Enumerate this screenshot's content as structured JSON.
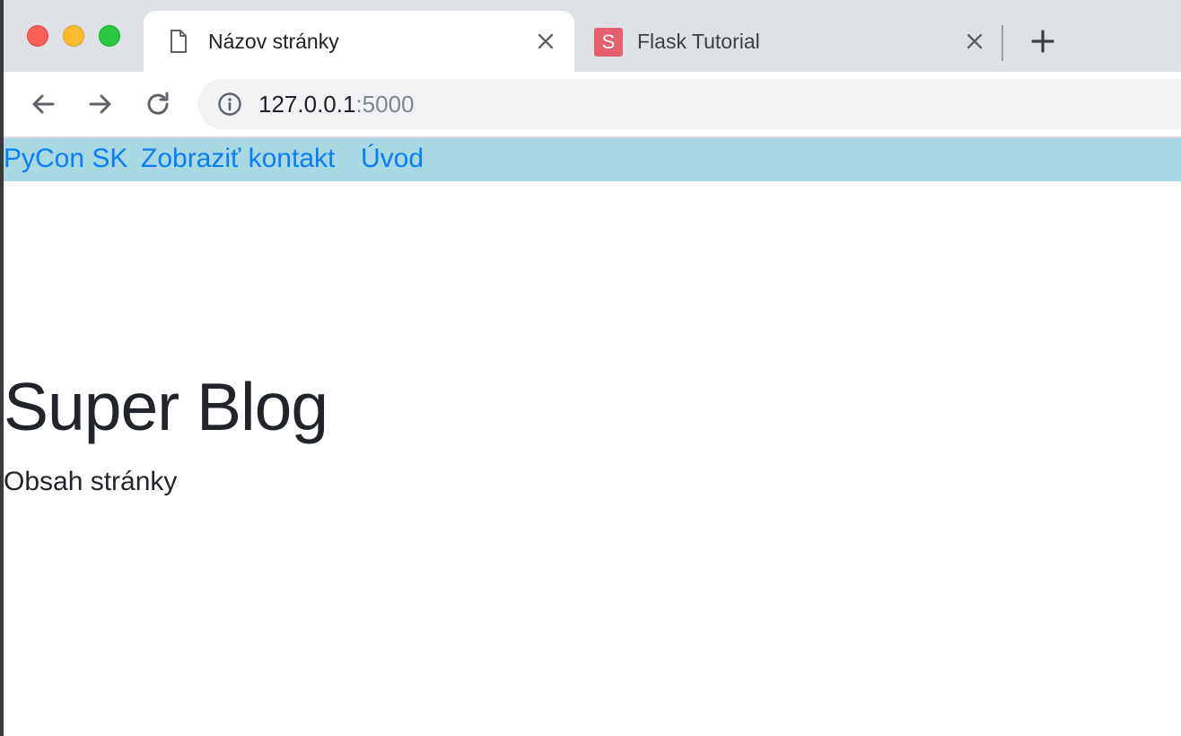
{
  "browser": {
    "tabs": [
      {
        "title": "Názov stránky",
        "active": true,
        "icon": "document-icon"
      },
      {
        "title": "Flask Tutorial",
        "active": false,
        "icon": "s-favicon",
        "favicon_letter": "S"
      }
    ],
    "address": {
      "host": "127.0.0.1",
      "port": ":5000"
    },
    "accent_color": "#a8d8e2"
  },
  "page": {
    "nav": [
      "PyCon SK",
      "Zobraziť kontakt",
      "Úvod"
    ],
    "heading": "Super Blog",
    "content": "Obsah stránky"
  }
}
